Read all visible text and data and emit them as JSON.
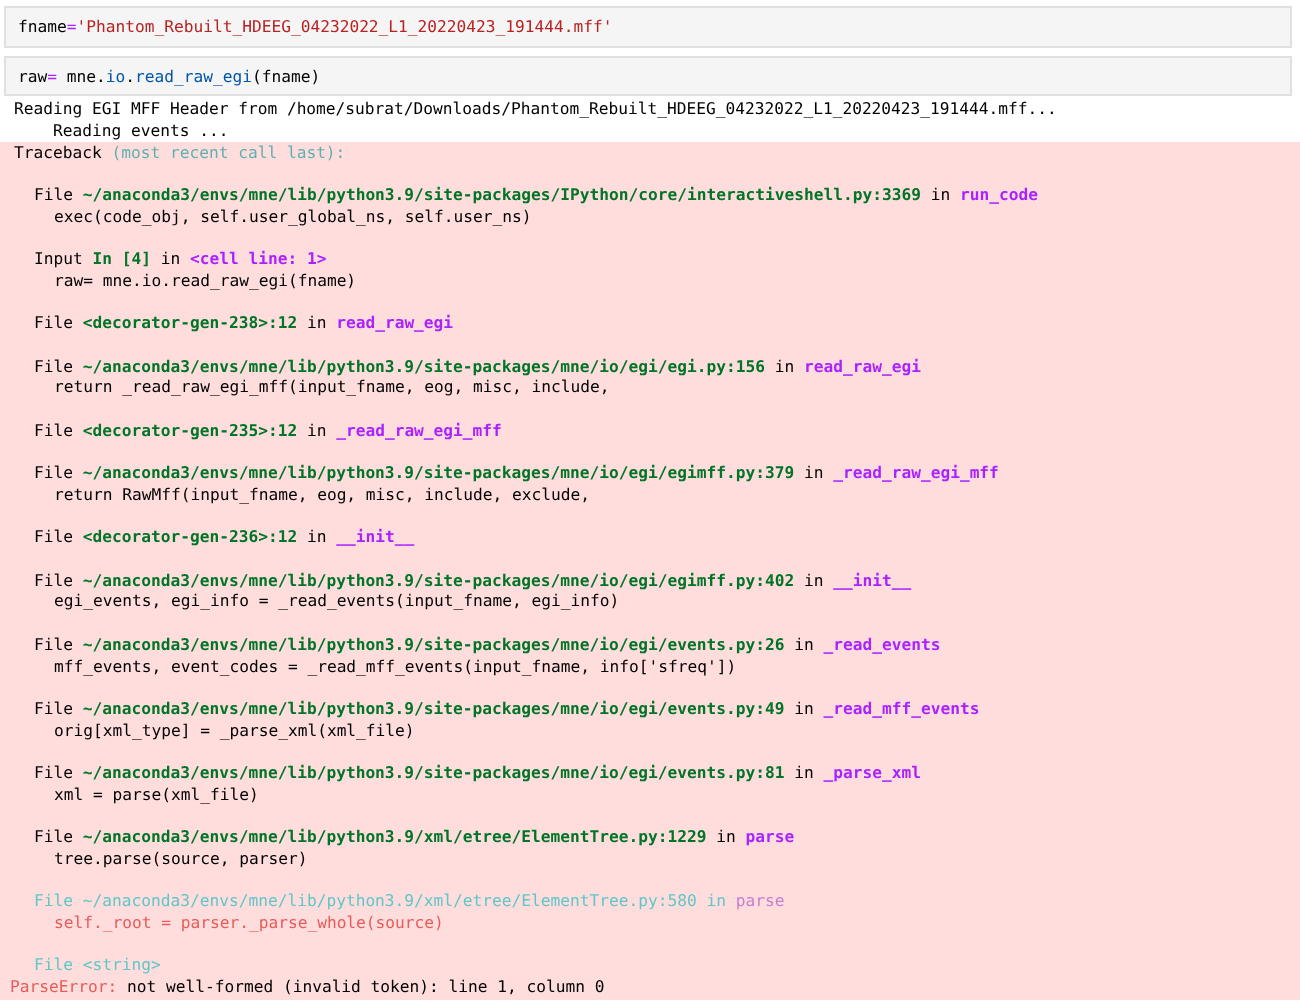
{
  "cells": [
    {
      "tokens": [
        {
          "text": "fname",
          "kind": "plain"
        },
        {
          "text": "=",
          "kind": "operator"
        },
        {
          "text": "'Phantom_Rebuilt_HDEEG_04232022_L1_20220423_191444.mff'",
          "kind": "string"
        }
      ]
    },
    {
      "tokens": [
        {
          "text": "raw",
          "kind": "plain"
        },
        {
          "text": "=",
          "kind": "operator"
        },
        {
          "text": " mne.",
          "kind": "plain"
        },
        {
          "text": "io",
          "kind": "attr"
        },
        {
          "text": ".",
          "kind": "plain"
        },
        {
          "text": "read_raw_egi",
          "kind": "attr"
        },
        {
          "text": "(fname)",
          "kind": "plain"
        }
      ]
    }
  ],
  "stdout": [
    "Reading EGI MFF Header from /home/subrat/Downloads/Phantom_Rebuilt_HDEEG_04232022_L1_20220423_191444.mff...",
    "    Reading events ..."
  ],
  "traceback": {
    "label": "Traceback",
    "note": "(most recent call last):",
    "frames": [
      {
        "prefix": "File",
        "location": "~/anaconda3/envs/mne/lib/python3.9/site-packages/IPython/core/interactiveshell.py:3369",
        "connector": "in",
        "func": "run_code",
        "code": "exec(code_obj, self.user_global_ns, self.user_ns)",
        "dim": false
      },
      {
        "prefix": "Input",
        "location": "In [4]",
        "connector": "in",
        "func": "<cell line: 1>",
        "code": "raw= mne.io.read_raw_egi(fname)",
        "dim": false
      },
      {
        "prefix": "File",
        "location": "<decorator-gen-238>:12",
        "connector": "in",
        "func": "read_raw_egi",
        "dim": false
      },
      {
        "prefix": "File",
        "location": "~/anaconda3/envs/mne/lib/python3.9/site-packages/mne/io/egi/egi.py:156",
        "connector": "in",
        "func": "read_raw_egi",
        "code": "return _read_raw_egi_mff(input_fname, eog, misc, include,",
        "dim": false
      },
      {
        "prefix": "File",
        "location": "<decorator-gen-235>:12",
        "connector": "in",
        "func": "_read_raw_egi_mff",
        "dim": false
      },
      {
        "prefix": "File",
        "location": "~/anaconda3/envs/mne/lib/python3.9/site-packages/mne/io/egi/egimff.py:379",
        "connector": "in",
        "func": "_read_raw_egi_mff",
        "code": "return RawMff(input_fname, eog, misc, include, exclude,",
        "dim": false
      },
      {
        "prefix": "File",
        "location": "<decorator-gen-236>:12",
        "connector": "in",
        "func": "__init__",
        "dim": false
      },
      {
        "prefix": "File",
        "location": "~/anaconda3/envs/mne/lib/python3.9/site-packages/mne/io/egi/egimff.py:402",
        "connector": "in",
        "func": "__init__",
        "code": "egi_events, egi_info = _read_events(input_fname, egi_info)",
        "dim": false
      },
      {
        "prefix": "File",
        "location": "~/anaconda3/envs/mne/lib/python3.9/site-packages/mne/io/egi/events.py:26",
        "connector": "in",
        "func": "_read_events",
        "code": "mff_events, event_codes = _read_mff_events(input_fname, info['sfreq'])",
        "dim": false
      },
      {
        "prefix": "File",
        "location": "~/anaconda3/envs/mne/lib/python3.9/site-packages/mne/io/egi/events.py:49",
        "connector": "in",
        "func": "_read_mff_events",
        "code": "orig[xml_type] = _parse_xml(xml_file)",
        "dim": false
      },
      {
        "prefix": "File",
        "location": "~/anaconda3/envs/mne/lib/python3.9/site-packages/mne/io/egi/events.py:81",
        "connector": "in",
        "func": "_parse_xml",
        "code": "xml = parse(xml_file)",
        "dim": false
      },
      {
        "prefix": "File",
        "location": "~/anaconda3/envs/mne/lib/python3.9/xml/etree/ElementTree.py:1229",
        "connector": "in",
        "func": "parse",
        "code": "tree.parse(source, parser)",
        "dim": false
      },
      {
        "prefix": "File",
        "location": "~/anaconda3/envs/mne/lib/python3.9/xml/etree/ElementTree.py:580",
        "connector": "in",
        "func": "parse",
        "code": "self._root = parser._parse_whole(source)",
        "dim": true
      },
      {
        "prefix": "File",
        "location": "<string>",
        "dim": true
      }
    ],
    "error": {
      "type": "ParseError:",
      "message": "not well-formed (invalid token): line 1, column 0"
    }
  }
}
